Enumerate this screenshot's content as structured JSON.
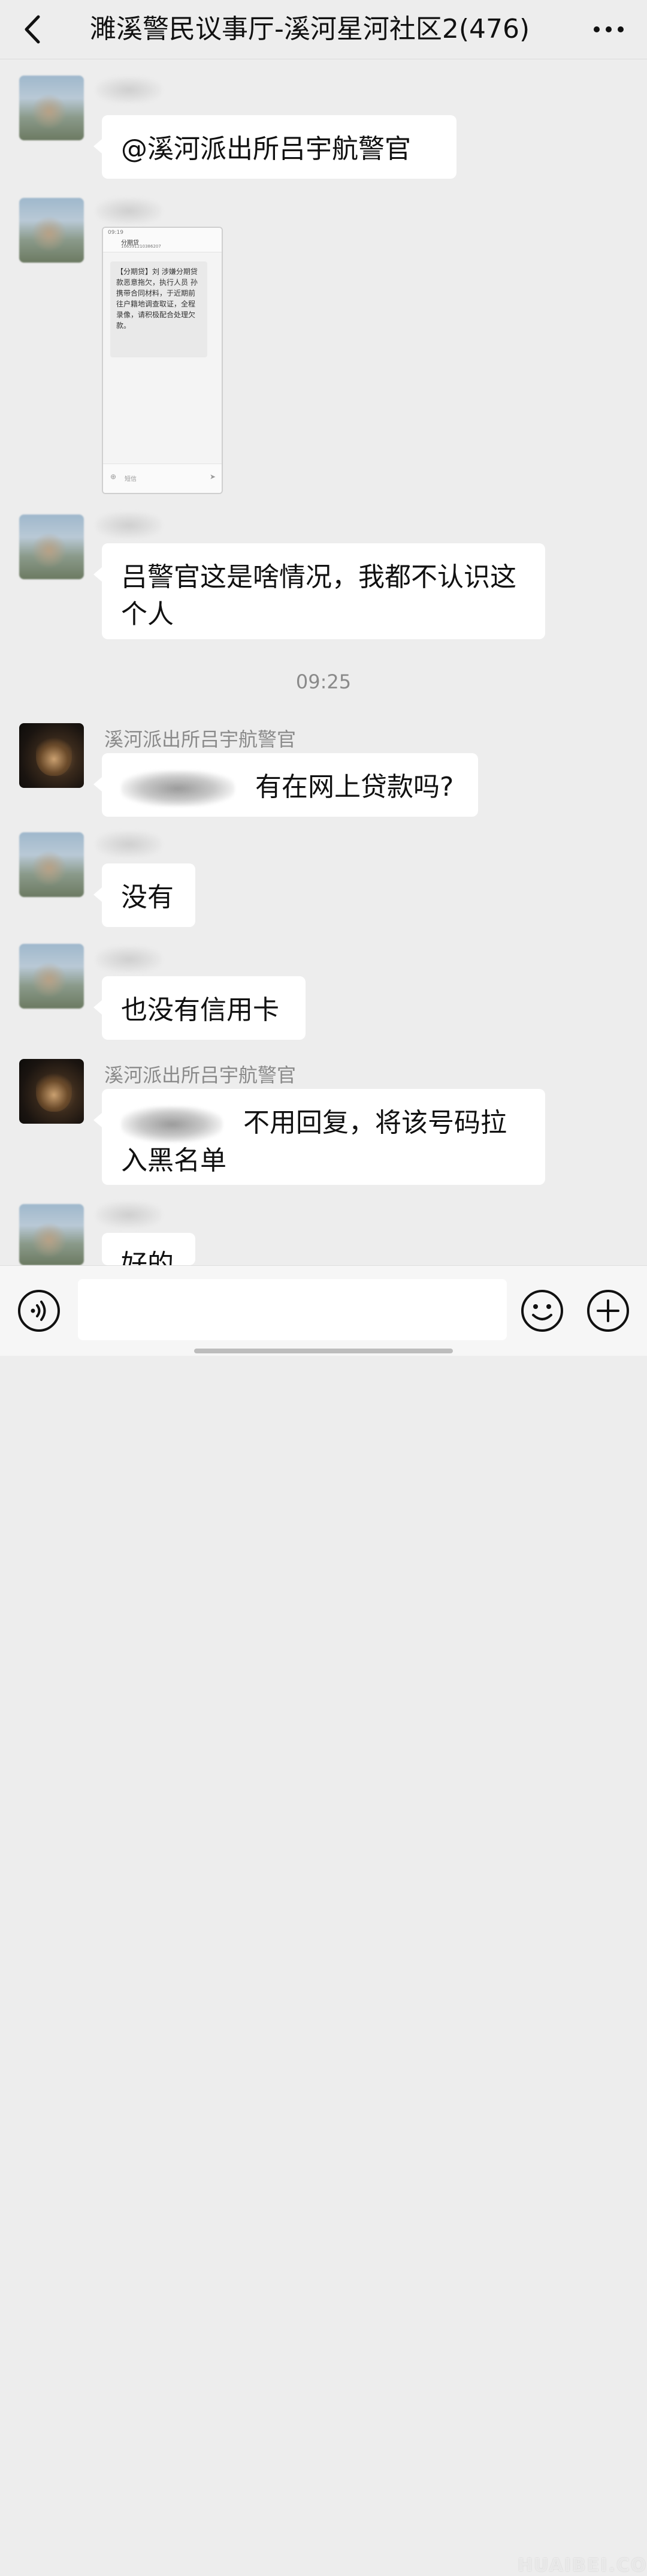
{
  "header": {
    "title": "濉溪警民议事厅-溪河星河社区2(476)"
  },
  "messages": [
    {
      "text": "@溪河派出所吕宇航警官"
    },
    {
      "screenshot": {
        "status_time": "09:19",
        "sender": "分期贷",
        "number": "106591210386207",
        "message": "【分期贷】刘 涉嫌分期贷款恶意拖欠，执行人员 孙 携带合同材料，于近期前往户籍地调查取证，全程录像，请积极配合处理欠款。",
        "input_placeholder": "短信"
      }
    },
    {
      "text": "吕警官这是啥情况，我都不认识这个人"
    },
    {
      "nickname": "溪河派出所吕宇航警官",
      "text": "有在网上贷款吗?"
    },
    {
      "text": "没有"
    },
    {
      "text": "也没有信用卡"
    },
    {
      "nickname": "溪河派出所吕宇航警官",
      "text": "不用回复，将该号码拉入黑名单"
    },
    {
      "text": "好的"
    }
  ],
  "time_divider": "09:25",
  "watermark": "HUAIBEI.COM",
  "icons": {
    "back": "chevron-left-icon",
    "more": "more-dots-icon",
    "voice": "voice-icon",
    "emoji": "emoji-icon",
    "plus": "plus-icon"
  }
}
